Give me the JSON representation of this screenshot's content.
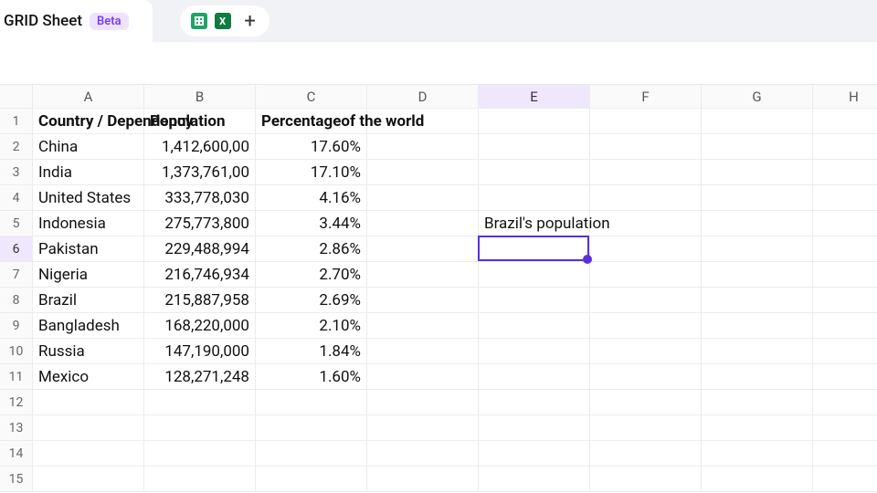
{
  "header": {
    "tab_title": "GRID Sheet",
    "badge": "Beta"
  },
  "tools": {
    "google_sheets": "Google Sheets",
    "excel": "Excel",
    "add": "+"
  },
  "columns": [
    "A",
    "B",
    "C",
    "D",
    "E",
    "F",
    "G",
    "H"
  ],
  "active_column": "E",
  "active_row": 6,
  "selected_cell": "E6",
  "data": {
    "headers": {
      "A1": "Country / Dependency",
      "B1": "Population",
      "C1": "Percentageof the world"
    },
    "rows": [
      {
        "n": 2,
        "country": "China",
        "pop": "1,412,600,00",
        "pct": "17.60%"
      },
      {
        "n": 3,
        "country": "India",
        "pop": "1,373,761,00",
        "pct": "17.10%"
      },
      {
        "n": 4,
        "country": "United States",
        "pop": "333,778,030",
        "pct": "4.16%"
      },
      {
        "n": 5,
        "country": "Indonesia",
        "pop": "275,773,800",
        "pct": "3.44%"
      },
      {
        "n": 6,
        "country": "Pakistan",
        "pop": "229,488,994",
        "pct": "2.86%"
      },
      {
        "n": 7,
        "country": "Nigeria",
        "pop": "216,746,934",
        "pct": "2.70%"
      },
      {
        "n": 8,
        "country": "Brazil",
        "pop": "215,887,958",
        "pct": "2.69%"
      },
      {
        "n": 9,
        "country": "Bangladesh",
        "pop": "168,220,000",
        "pct": "2.10%"
      },
      {
        "n": 10,
        "country": "Russia",
        "pop": "147,190,000",
        "pct": "1.84%"
      },
      {
        "n": 11,
        "country": "Mexico",
        "pop": "128,271,248",
        "pct": "1.60%"
      }
    ],
    "note_E5": "Brazil's population"
  },
  "empty_rows": [
    12,
    13,
    14,
    15
  ]
}
